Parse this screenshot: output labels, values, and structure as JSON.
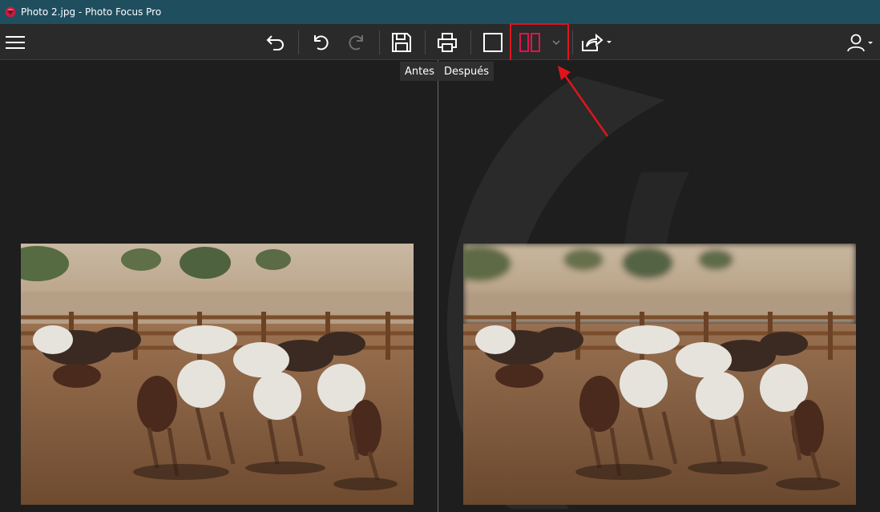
{
  "window": {
    "title": "Photo 2.jpg - Photo Focus Pro"
  },
  "toolbar": {
    "menu_icon": "hamburger-menu-icon",
    "undo_all_icon": "undo-all-icon",
    "undo_icon": "undo-icon",
    "redo_icon": "redo-icon",
    "save_icon": "save-icon",
    "print_icon": "print-icon",
    "single_view_icon": "single-view-icon",
    "split_view_icon": "split-view-icon",
    "share_icon": "share-icon",
    "account_icon": "user-icon"
  },
  "compare": {
    "before_label": "Antes",
    "after_label": "Después"
  },
  "colors": {
    "titlebar": "#1f4e5f",
    "toolbar": "#2a2a2a",
    "canvas": "#1e1e1e",
    "accent": "#e0144f",
    "annotation": "#e0141c"
  }
}
